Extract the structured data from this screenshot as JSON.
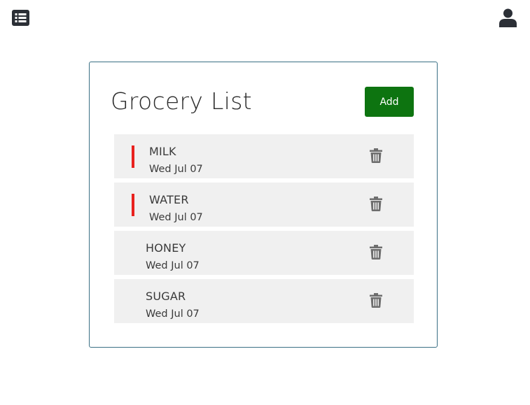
{
  "header": {
    "menu_icon": "list-alt-icon",
    "user_icon": "user-icon"
  },
  "card": {
    "title": "Grocery List",
    "add_label": "Add",
    "add_color": "#0d7410"
  },
  "items": [
    {
      "name": "MILK",
      "date": "Wed Jul 07",
      "flagged": true,
      "delete_icon": "trash-icon"
    },
    {
      "name": "WATER",
      "date": "Wed Jul 07",
      "flagged": true,
      "delete_icon": "trash-icon"
    },
    {
      "name": "HONEY",
      "date": "Wed Jul 07",
      "flagged": false,
      "delete_icon": "trash-icon"
    },
    {
      "name": "SUGAR",
      "date": "Wed Jul 07",
      "flagged": false,
      "delete_icon": "trash-icon"
    }
  ],
  "colors": {
    "flag": "#e8211e",
    "row_background": "#f0f0f0",
    "card_border": "#3a6f84",
    "icon": "#6e6e6e"
  }
}
